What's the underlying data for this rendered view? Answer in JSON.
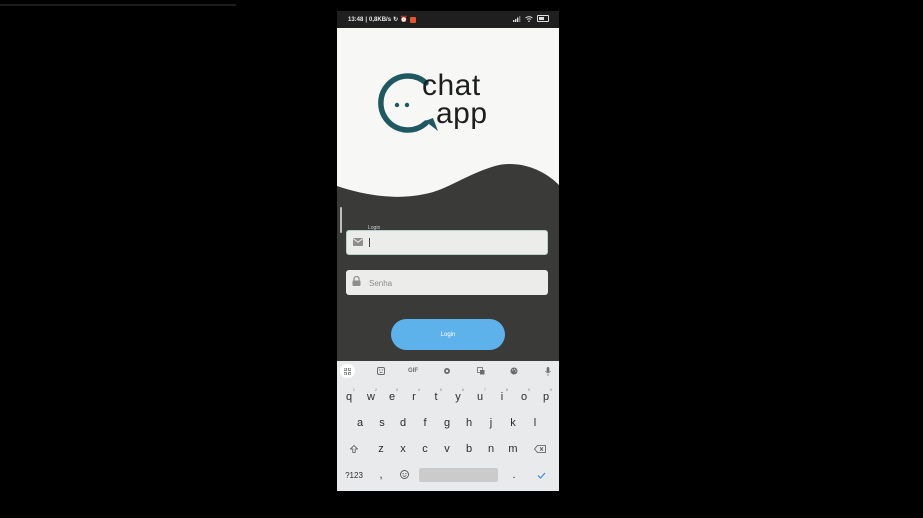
{
  "status_bar": {
    "time": "13:48",
    "speed": "0,8KB/s",
    "battery_level": "80"
  },
  "logo": {
    "word1": "chat",
    "word2": "app",
    "accent_color": "#1e5961"
  },
  "login_form": {
    "login_label": "Login",
    "login_value": "",
    "password_placeholder": "Senha",
    "submit_label": "Login"
  },
  "keyboard": {
    "toolbar": [
      "apps-icon",
      "sticker-icon",
      "GIF",
      "settings-icon",
      "translate-icon",
      "palette-icon",
      "mic-icon"
    ],
    "gif_label": "GIF",
    "row1": [
      {
        "key": "q",
        "hint": "1"
      },
      {
        "key": "w",
        "hint": "2"
      },
      {
        "key": "e",
        "hint": "3"
      },
      {
        "key": "r",
        "hint": "4"
      },
      {
        "key": "t",
        "hint": "5"
      },
      {
        "key": "y",
        "hint": "6"
      },
      {
        "key": "u",
        "hint": "7"
      },
      {
        "key": "i",
        "hint": "8"
      },
      {
        "key": "o",
        "hint": "9"
      },
      {
        "key": "p",
        "hint": "0"
      }
    ],
    "row2": [
      "a",
      "s",
      "d",
      "f",
      "g",
      "h",
      "j",
      "k",
      "l"
    ],
    "row3": [
      "z",
      "x",
      "c",
      "v",
      "b",
      "n",
      "m"
    ],
    "symbols_label": "?123",
    "comma": ",",
    "period": "."
  }
}
